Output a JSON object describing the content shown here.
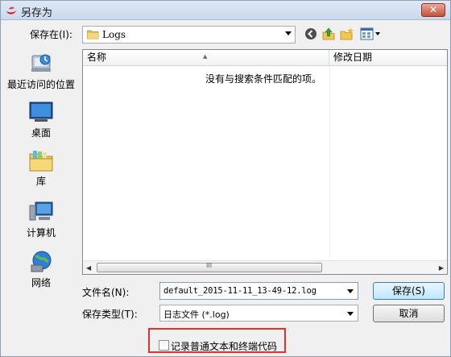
{
  "window": {
    "title": "另存为",
    "close_glyph": "✕"
  },
  "location": {
    "label": "保存在(I):",
    "value": "Logs"
  },
  "toolbar": {
    "icons": [
      "back-icon",
      "up-folder-icon",
      "new-folder-icon",
      "view-menu-icon"
    ]
  },
  "places": [
    {
      "label": "最近访问的位置",
      "icon": "recent-places-icon"
    },
    {
      "label": "桌面",
      "icon": "desktop-icon"
    },
    {
      "label": "库",
      "icon": "libraries-icon"
    },
    {
      "label": "计算机",
      "icon": "computer-icon"
    },
    {
      "label": "网络",
      "icon": "network-icon"
    }
  ],
  "file_list": {
    "columns": [
      "名称",
      "修改日期"
    ],
    "empty_message": "没有与搜索条件匹配的项。",
    "thumb_grip": "III"
  },
  "filename": {
    "label": "文件名(N):",
    "value": "default_2015-11-11_13-49-12.log"
  },
  "filetype": {
    "label": "保存类型(T):",
    "value": "日志文件 (*.log)"
  },
  "buttons": {
    "save": "保存(S)",
    "cancel": "取消"
  },
  "option": {
    "label": "记录普通文本和终端代码",
    "checked": false
  },
  "colors": {
    "highlight_border": "#e6312a",
    "title_bar": "#c9d9ee",
    "close_button": "#c4503a"
  }
}
